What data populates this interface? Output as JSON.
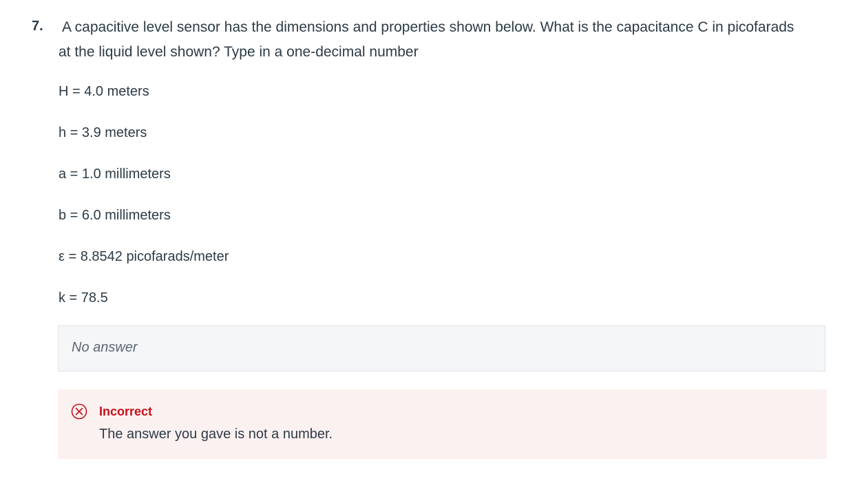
{
  "question": {
    "number": "7.",
    "text": "A capacitive level sensor has the dimensions and properties shown below. What is the capacitance C in picofarads at the liquid level shown? Type in a one-decimal number",
    "parameters": [
      "H = 4.0 meters",
      "h = 3.9 meters",
      "a = 1.0 millimeters",
      "b = 6.0 millimeters",
      "ε = 8.8542 picofarads/meter",
      "k = 78.5"
    ]
  },
  "answer": {
    "value": "No answer"
  },
  "feedback": {
    "status": "Incorrect",
    "message": "The answer you gave is not a number.",
    "icon": "incorrect-circle-x-icon",
    "color": "#c4121a",
    "background": "#fcf1f1"
  }
}
